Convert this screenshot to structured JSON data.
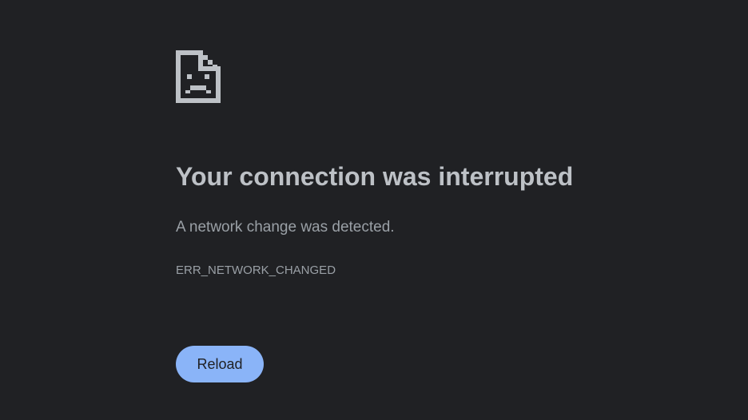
{
  "icon": "sad-document-icon",
  "colors": {
    "background": "#202124",
    "title": "#bdc1c6",
    "text": "#9aa0a6",
    "button": "#8ab4f8",
    "button_text": "#202124"
  },
  "error": {
    "title": "Your connection was interrupted",
    "message": "A network change was detected.",
    "code": "ERR_NETWORK_CHANGED"
  },
  "actions": {
    "reload_label": "Reload"
  }
}
